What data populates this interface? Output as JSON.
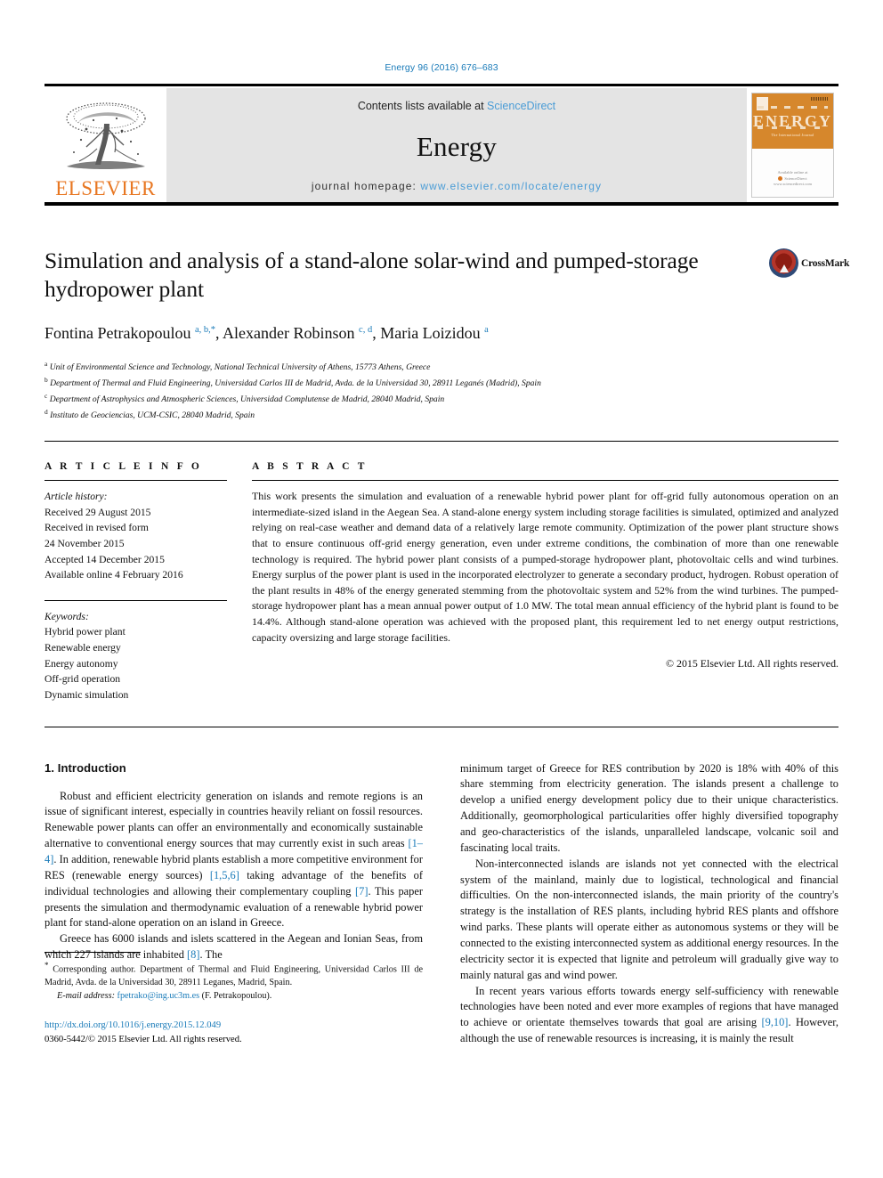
{
  "running_head": "Energy 96 (2016) 676–683",
  "masthead": {
    "publisher_name": "ELSEVIER",
    "publisher_logo_icon": "elsevier-tree-icon",
    "contents_prefix": "Contents lists available at ",
    "contents_link": "ScienceDirect",
    "journal_name": "Energy",
    "homepage_label": "journal homepage: ",
    "homepage_url": "www.elsevier.com/locate/energy",
    "cover": {
      "title": "ENERGY",
      "subtitle": "The International Journal",
      "footer_line1": "Available online at",
      "footer_line2": "ScienceDirect",
      "footer_line3": "www.sciencedirect.com"
    }
  },
  "article": {
    "title": "Simulation and analysis of a stand-alone solar-wind and pumped-storage hydropower plant",
    "authors_html": "Fontina Petrakopoulou <sup>a, b,</sup><sup class=\"star\">*</sup>, Alexander Robinson <sup>c, d</sup>, Maria Loizidou <sup>a</sup>",
    "crossmark_label": "CrossMark",
    "affiliations": [
      {
        "marker": "a",
        "text": "Unit of Environmental Science and Technology, National Technical University of Athens, 15773 Athens, Greece"
      },
      {
        "marker": "b",
        "text": "Department of Thermal and Fluid Engineering, Universidad Carlos III de Madrid, Avda. de la Universidad 30, 28911 Leganés (Madrid), Spain"
      },
      {
        "marker": "c",
        "text": "Department of Astrophysics and Atmospheric Sciences, Universidad Complutense de Madrid, 28040 Madrid, Spain"
      },
      {
        "marker": "d",
        "text": "Instituto de Geociencias, UCM-CSIC, 28040 Madrid, Spain"
      }
    ]
  },
  "article_info": {
    "heading": "A R T I C L E   I N F O",
    "history_label": "Article history:",
    "history": [
      "Received 29 August 2015",
      "Received in revised form",
      "24 November 2015",
      "Accepted 14 December 2015",
      "Available online 4 February 2016"
    ],
    "keywords_label": "Keywords:",
    "keywords": [
      "Hybrid power plant",
      "Renewable energy",
      "Energy autonomy",
      "Off-grid operation",
      "Dynamic simulation"
    ]
  },
  "abstract": {
    "heading": "A B S T R A C T",
    "text": "This work presents the simulation and evaluation of a renewable hybrid power plant for off-grid fully autonomous operation on an intermediate-sized island in the Aegean Sea. A stand-alone energy system including storage facilities is simulated, optimized and analyzed relying on real-case weather and demand data of a relatively large remote community. Optimization of the power plant structure shows that to ensure continuous off-grid energy generation, even under extreme conditions, the combination of more than one renewable technology is required. The hybrid power plant consists of a pumped-storage hydropower plant, photovoltaic cells and wind turbines. Energy surplus of the power plant is used in the incorporated electrolyzer to generate a secondary product, hydrogen. Robust operation of the plant results in 48% of the energy generated stemming from the photovoltaic system and 52% from the wind turbines. The pumped-storage hydropower plant has a mean annual power output of 1.0 MW. The total mean annual efficiency of the hybrid plant is found to be 14.4%. Although stand-alone operation was achieved with the proposed plant, this requirement led to net energy output restrictions, capacity oversizing and large storage facilities.",
    "copyright": "© 2015 Elsevier Ltd. All rights reserved."
  },
  "body": {
    "section_number_title": "1. Introduction",
    "left_paragraphs_html": [
      "Robust and efficient electricity generation on islands and remote regions is an issue of significant interest, especially in countries heavily reliant on fossil resources. Renewable power plants can offer an environmentally and economically sustainable alternative to conventional energy sources that may currently exist in such areas <span class=\"ref\">[1&ndash;4]</span>. In addition, renewable hybrid plants establish a more competitive environment for RES (renewable energy sources) <span class=\"ref\">[1,5,6]</span> taking advantage of the benefits of individual technologies and allowing their complementary coupling <span class=\"ref\">[7]</span>. This paper presents the simulation and thermodynamic evaluation of a renewable hybrid power plant for stand-alone operation on an island in Greece.",
      "Greece has 6000 islands and islets scattered in the Aegean and Ionian Seas, from which 227 islands are inhabited <span class=\"ref\">[8]</span>. The"
    ],
    "right_paragraphs_html": [
      "minimum target of Greece for RES contribution by 2020 is 18% with 40% of this share stemming from electricity generation. The islands present a challenge to develop a unified energy development policy due to their unique characteristics. Additionally, geomorphological particularities offer highly diversified topography and geo-characteristics of the islands, unparalleled landscape, volcanic soil and fascinating local traits.",
      "Non-interconnected islands are islands not yet connected with the electrical system of the mainland, mainly due to logistical, technological and financial difficulties. On the non-interconnected islands, the main priority of the country's strategy is the installation of RES plants, including hybrid RES plants and offshore wind parks. These plants will operate either as autonomous systems or they will be connected to the existing interconnected system as additional energy resources. In the electricity sector it is expected that lignite and petroleum will gradually give way to mainly natural gas and wind power.",
      "In recent years various efforts towards energy self-sufficiency with renewable technologies have been noted and ever more examples of regions that have managed to achieve or orientate themselves towards that goal are arising <span class=\"ref\">[9,10]</span>. However, although the use of renewable resources is increasing, it is mainly the result"
    ]
  },
  "footnote": {
    "corresponding_html": "<span class=\"star\">*</span> Corresponding author. Department of Thermal and Fluid Engineering, Universidad Carlos III de Madrid, Avda. de la Universidad 30, 28911 Leganes, Madrid, Spain.",
    "email_label": "E-mail address:",
    "email": "fpetrako@ing.uc3m.es",
    "email_owner": "(F. Petrakopoulou).",
    "doi": "http://dx.doi.org/10.1016/j.energy.2015.12.049",
    "issn_line": "0360-5442/© 2015 Elsevier Ltd. All rights reserved."
  },
  "colors": {
    "link_blue": "#1a7bb9",
    "sciencedirect_blue": "#4a9cd6",
    "elsevier_orange": "#E87722",
    "cover_orange": "#d6872c",
    "masthead_gray": "#e4e4e4"
  }
}
